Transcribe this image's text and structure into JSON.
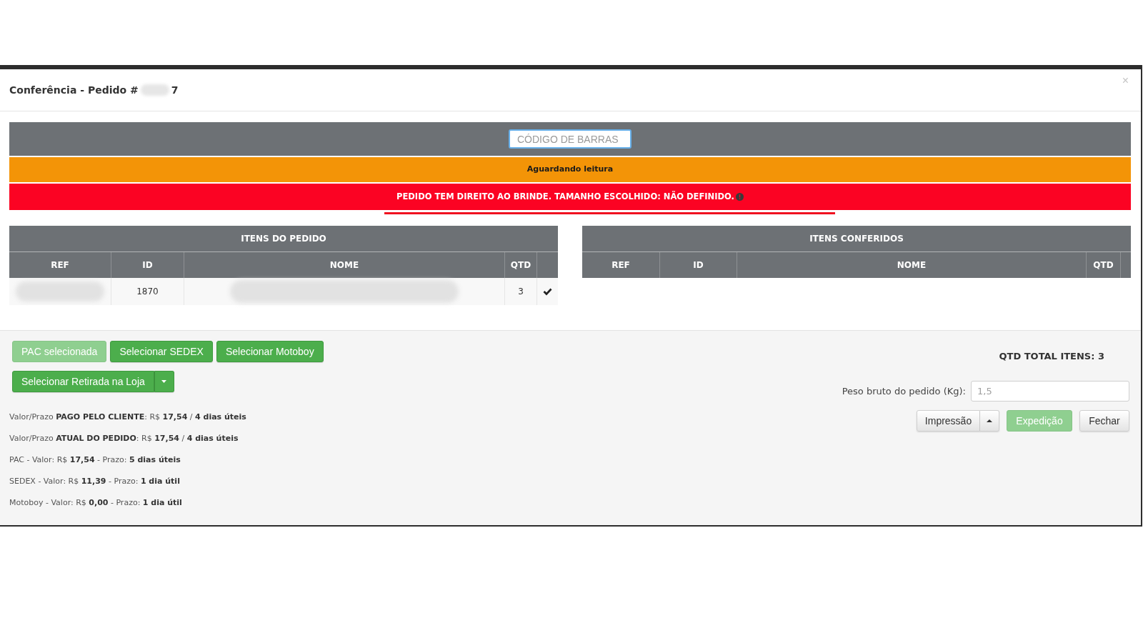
{
  "modal": {
    "title": "Conferência - Pedido #",
    "title_end": "7",
    "close": "×"
  },
  "barcode": {
    "placeholder": "CÓDIGO DE BARRAS",
    "focused": true
  },
  "status_banner": "Aguardando leitura",
  "alert": "PEDIDO TEM DIREITO AO BRINDE. TAMANHO ESCOLHIDO: NÃO DEFINIDO.",
  "tables": [
    {
      "kind": "order",
      "title": "ITENS DO PEDIDO",
      "columns": [
        "REF",
        "ID",
        "NOME",
        "QTD"
      ],
      "rows": [
        {
          "id": "1870",
          "qtd": "3",
          "checked": true
        }
      ]
    },
    {
      "kind": "checked",
      "title": "ITENS CONFERIDOS",
      "columns": [
        "REF",
        "ID",
        "NOME",
        "QTD"
      ]
    }
  ],
  "shipping_buttons": [
    {
      "label": "PAC selecionada",
      "selected": true
    },
    {
      "label": "Selecionar SEDEX",
      "selected": false
    },
    {
      "label": "Selecionar Motoboy",
      "selected": false
    }
  ],
  "pickup_button": {
    "label": "Selecionar Retirada na Loja",
    "selected": false
  },
  "shipping_info": [
    "Valor/Prazo **PAGO PELO CLIENTE**: R$ **17,54** / **4 dias úteis**",
    "Valor/Prazo **ATUAL DO PEDIDO**: R$ **17,54** / **4 dias úteis**",
    "PAC - Valor: R$ **17,54** - Prazo: **5 dias úteis**",
    "SEDEX - Valor: R$ **11,39** - Prazo: **1 dia útil**",
    "Motoboy - Valor: R$ **0,00** - Prazo: **1 dia útil**"
  ],
  "total": "QTD TOTAL ITENS: 3",
  "weight": {
    "label": "Peso bruto do pedido (Kg):",
    "placeholder": "1,5"
  },
  "actions": [
    {
      "kind": "split",
      "label": "Impressão",
      "disabled": false
    },
    {
      "kind": "success",
      "label": "Expedição",
      "disabled": true
    },
    {
      "kind": "default",
      "label": "Fechar",
      "disabled": false
    }
  ]
}
